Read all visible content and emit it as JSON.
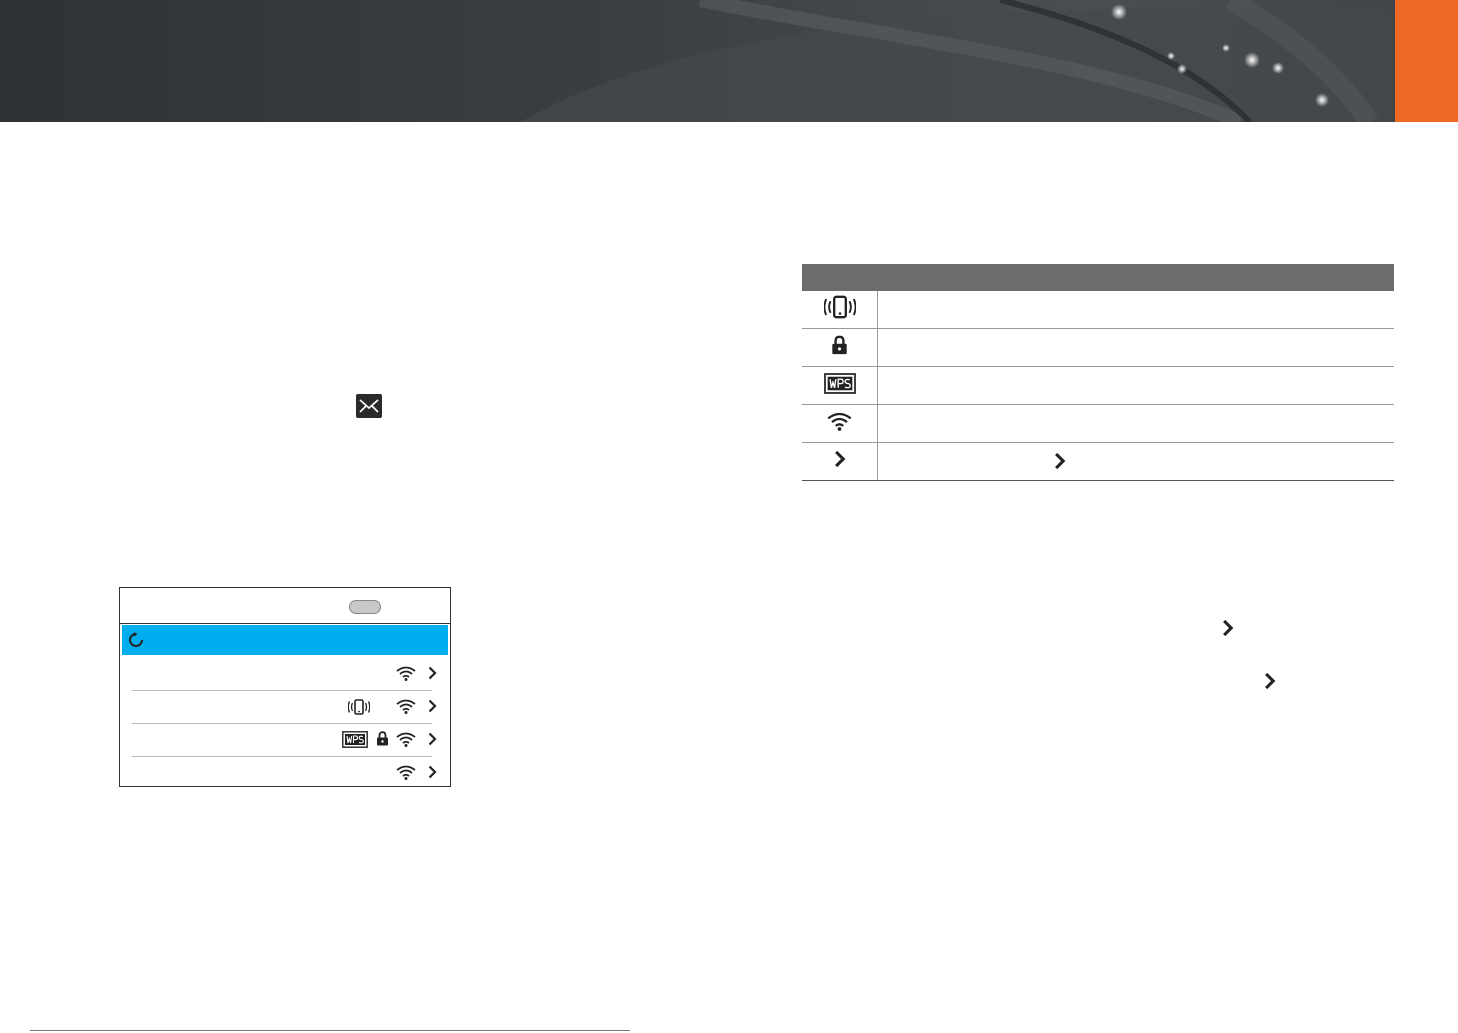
{
  "banner": {
    "tab_color": "#ee6a24",
    "icon": "decorative-light-streaks"
  },
  "mail_icon": "envelope-icon",
  "camera_screen": {
    "highlight_color": "#00aeef",
    "toggle_icon": "toggle-pill-icon",
    "refresh_icon": "refresh-icon",
    "networks": [
      {
        "icons": [
          "wifi-icon",
          "chevron-right-icon"
        ]
      },
      {
        "icons": [
          "phone-vibrate-icon",
          "wifi-icon",
          "chevron-right-icon"
        ]
      },
      {
        "icons": [
          "wps-icon",
          "lock-icon",
          "wifi-icon",
          "chevron-right-icon"
        ]
      },
      {
        "icons": [
          "wifi-icon",
          "chevron-right-icon"
        ]
      }
    ]
  },
  "icon_table": {
    "header_color": "#6d6d6d",
    "rows": [
      {
        "icon": "phone-vibrate-icon"
      },
      {
        "icon": "lock-icon"
      },
      {
        "icon": "wps-icon"
      },
      {
        "icon": "wifi-icon"
      },
      {
        "icon": "chevron-right-icon",
        "inline_icon": "chevron-right-icon"
      }
    ]
  },
  "body_icons": [
    "chevron-right-icon",
    "chevron-right-icon"
  ]
}
